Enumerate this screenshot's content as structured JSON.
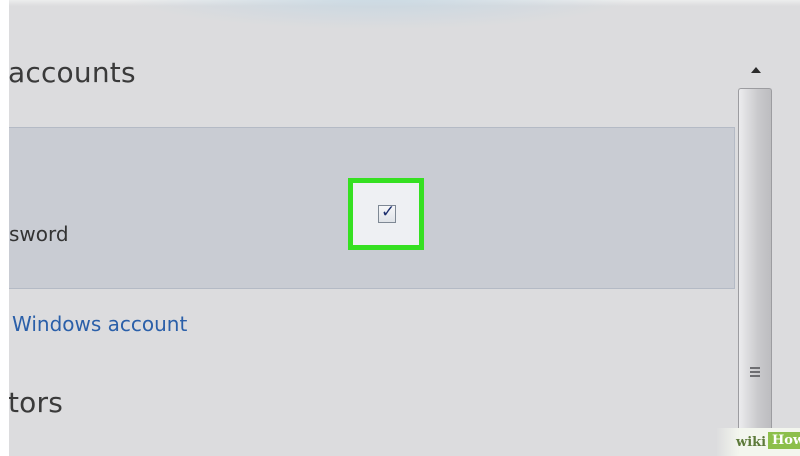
{
  "sections": {
    "accounts_title": "accounts",
    "tors_title": "tors"
  },
  "row": {
    "label": "sword",
    "checkbox_checked": true,
    "checkbox_glyph": "✓"
  },
  "link_text": "Windows account",
  "scrollbar": {
    "up_arrow_icon": "triangle-up"
  },
  "watermark": {
    "wiki": "wiki",
    "how": "How"
  },
  "colors": {
    "highlight": "#35e021",
    "link": "#2a5fa9",
    "panel": "#c9ccd3"
  }
}
